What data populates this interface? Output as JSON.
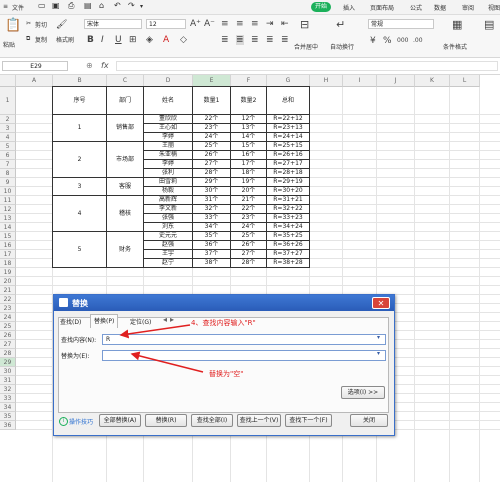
{
  "menu": {
    "file": "文件",
    "start": "开始",
    "tabs": [
      "插入",
      "页面布局",
      "公式",
      "数据",
      "审阅",
      "视图"
    ]
  },
  "ribbon": {
    "paste": "粘贴",
    "cut": "剪切",
    "copy": "复制",
    "format_painter": "格式刷",
    "font_name": "宋体",
    "font_size": "12",
    "merge_center": "合并居中",
    "wrap": "自动换行",
    "number_format": "常规",
    "conditional_format": "条件格式",
    "currency": "¥",
    "percent": "%"
  },
  "formula_bar": {
    "cell_ref": "E29",
    "fx": "fx",
    "value": ""
  },
  "sheet": {
    "columns": [
      "A",
      "B",
      "C",
      "D",
      "E",
      "F",
      "G",
      "H",
      "I",
      "J",
      "K",
      "L"
    ],
    "rows": [
      "1",
      "2",
      "3",
      "4",
      "5",
      "6",
      "7",
      "8",
      "9",
      "10",
      "11",
      "12",
      "13",
      "14",
      "15",
      "16",
      "17",
      "18",
      "19",
      "20",
      "21",
      "22",
      "23",
      "24",
      "25",
      "26",
      "27",
      "28",
      "29",
      "30",
      "31",
      "32",
      "33",
      "34",
      "35",
      "36"
    ],
    "headers": [
      "序号",
      "部门",
      "姓名",
      "数量1",
      "数量2",
      "总和"
    ],
    "groups": [
      {
        "no": "1",
        "dept": "销售部"
      },
      {
        "no": "2",
        "dept": "市场部"
      },
      {
        "no": "3",
        "dept": "客服"
      },
      {
        "no": "4",
        "dept": "稽核"
      },
      {
        "no": "5",
        "dept": "财务"
      }
    ],
    "records": [
      [
        "董欣欣",
        "22个",
        "12个",
        "R=22+12"
      ],
      [
        "王心如",
        "23个",
        "13个",
        "R=23+13"
      ],
      [
        "李婷",
        "24个",
        "14个",
        "R=24+14"
      ],
      [
        "王丽",
        "25个",
        "15个",
        "R=25+15"
      ],
      [
        "朱亚楠",
        "26个",
        "16个",
        "R=26+16"
      ],
      [
        "李婷",
        "27个",
        "17个",
        "R=27+17"
      ],
      [
        "张利",
        "28个",
        "18个",
        "R=28+18"
      ],
      [
        "田雪莉",
        "29个",
        "19个",
        "R=29+19"
      ],
      [
        "杨毅",
        "30个",
        "20个",
        "R=30+20"
      ],
      [
        "高新辉",
        "31个",
        "21个",
        "R=31+21"
      ],
      [
        "李文新",
        "32个",
        "22个",
        "R=32+22"
      ],
      [
        "张强",
        "33个",
        "23个",
        "R=33+23"
      ],
      [
        "刘东",
        "34个",
        "24个",
        "R=34+24"
      ],
      [
        "史元元",
        "35个",
        "25个",
        "R=35+25"
      ],
      [
        "赵强",
        "36个",
        "26个",
        "R=36+26"
      ],
      [
        "王宇",
        "37个",
        "27个",
        "R=37+27"
      ],
      [
        "赵宁",
        "38个",
        "28个",
        "R=38+28"
      ]
    ]
  },
  "dialog": {
    "title": "替换",
    "tabs": [
      "查找(D)",
      "替换(P)",
      "定位(G)"
    ],
    "find_label": "查找内容(N):",
    "find_value": "R",
    "replace_label": "替换为(E):",
    "replace_value": "",
    "options_button": "选项(I) >>",
    "tips_link": "操作技巧",
    "buttons": [
      "全部替换(A)",
      "替换(R)",
      "查找全部(I)",
      "查找上一个(V)",
      "查找下一个(F)",
      "关闭"
    ]
  },
  "annotations": {
    "step4": "4、查找内容输入\"R\"",
    "replace_empty": "替换为\"空\""
  },
  "colors": {
    "accent_green": "#1bb05a",
    "dialog_title": "#2a5cb8",
    "annotation_red": "#e02020",
    "selected_column": "#cfe8d4"
  },
  "icons": [
    "file-menu-icon",
    "save-icon",
    "print-icon",
    "undo-icon",
    "redo-icon",
    "paste-icon",
    "bold-icon",
    "italic-icon",
    "underline-icon",
    "align-icon",
    "close-icon",
    "dropdown-icon",
    "info-icon"
  ]
}
